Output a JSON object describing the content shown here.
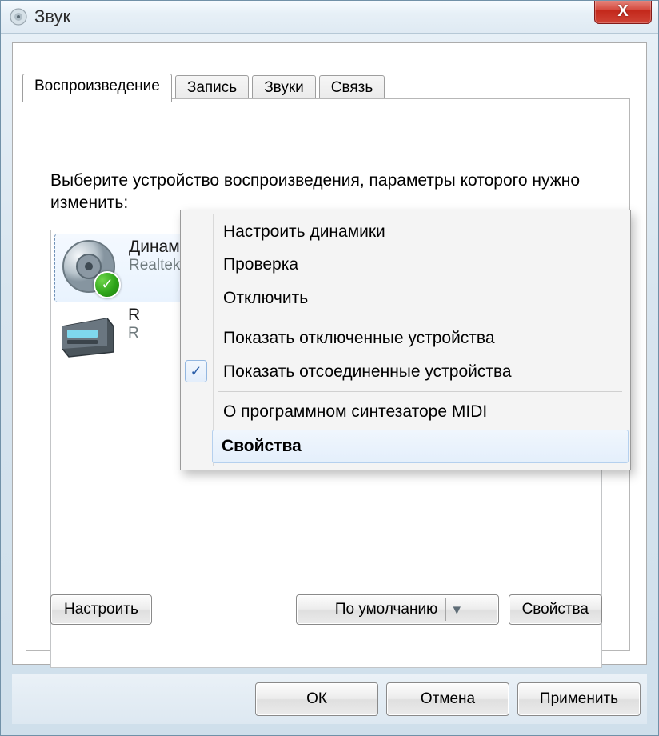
{
  "window": {
    "title": "Звук",
    "close_glyph": "X"
  },
  "tabs": [
    {
      "label": "Воспроизведение",
      "active": true
    },
    {
      "label": "Запись",
      "active": false
    },
    {
      "label": "Звуки",
      "active": false
    },
    {
      "label": "Связь",
      "active": false
    }
  ],
  "instruction": "Выберите устройство воспроизведения, параметры которого нужно изменить:",
  "devices": [
    {
      "title": "Динамики",
      "subtitle": "Realtek High Definition Audio",
      "selected": true,
      "default_badge": true
    },
    {
      "title_initial": "R",
      "sub_initial": "R",
      "selected": false,
      "default_badge": false
    }
  ],
  "context_menu": {
    "configure": "Настроить динамики",
    "test": "Проверка",
    "disable": "Отключить",
    "show_disabled": "Показать отключенные устройства",
    "show_disconnected": "Показать отсоединенные устройства",
    "show_disconnected_checked": true,
    "about_midi": "О программном синтезаторе MIDI",
    "properties": "Свойства"
  },
  "bottom_buttons": {
    "configure": "Настроить",
    "set_default": "По умолчанию",
    "properties": "Свойства"
  },
  "footer_buttons": {
    "ok": "ОК",
    "cancel": "Отмена",
    "apply": "Применить"
  }
}
